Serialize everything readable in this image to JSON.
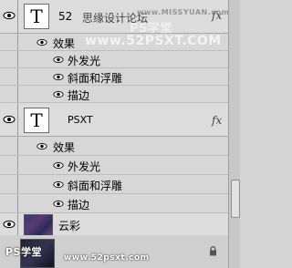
{
  "layers": [
    {
      "name": "52",
      "subtext": "思缘设计论坛",
      "thumb": "T",
      "fx": "fx"
    },
    {
      "name": "PSXT",
      "thumb": "T",
      "fx": "fx"
    },
    {
      "name": "云彩"
    }
  ],
  "effects_label": "效果",
  "effects": [
    "外发光",
    "斜面和浮雕",
    "描边"
  ],
  "watermarks": {
    "top_right": "www.MISSYUAN.com",
    "top_mid": "PS学堂",
    "mid": "www.52PSXT.COM",
    "bottom_left": "PS学堂",
    "bottom_mid": "www.52psxt.com"
  },
  "colors": {
    "panel_bg": "#d4d4d4",
    "selected": "#dcdcdc"
  }
}
